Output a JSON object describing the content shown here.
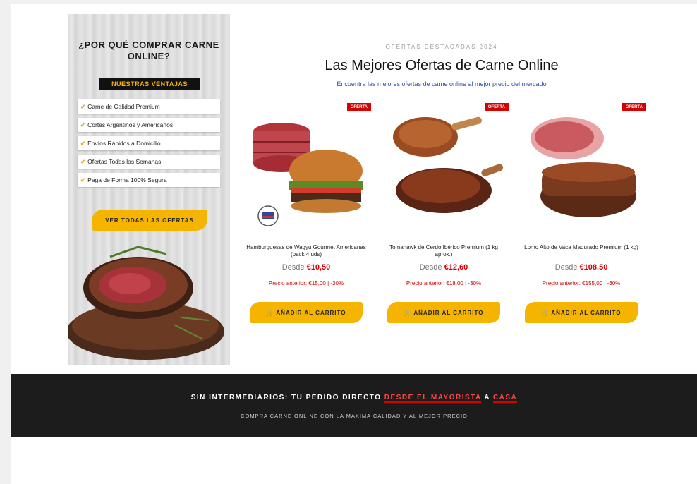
{
  "promo": {
    "title": "¿Por qué comprar carne online?",
    "badge": "NUESTRAS VENTAJAS",
    "benefits": [
      "Carne de Calidad Premium",
      "Cortes Argentinos y Americanos",
      "Envíos Rápidos a Domicilio",
      "Ofertas Todas las Semanas",
      "Paga de Forma 100% Segura"
    ],
    "cta": "VER TODAS LAS OFERTAS"
  },
  "heading": {
    "eyebrow": "OFERTAS DESTACADAS 2024",
    "title": "Las Mejores Ofertas de Carne Online",
    "tagline": "Encuentra las mejores ofertas de carne online al mejor precio del mercado"
  },
  "products": [
    {
      "tag": "OFERTA",
      "name": "Hamburguesas de Wagyu Gourmet Americanas (pack 4 uds)",
      "price_label": "Desde",
      "price": "€10,50",
      "saving": "Precio anterior: €15,00 | -30%",
      "buy": "AÑADIR AL CARRITO"
    },
    {
      "tag": "OFERTA",
      "name": "Tomahawk de Cerdo Ibérico Premium (1 kg aprox.)",
      "price_label": "Desde",
      "price": "€12,60",
      "saving": "Precio anterior: €18,00 | -30%",
      "buy": "AÑADIR AL CARRITO"
    },
    {
      "tag": "OFERTA",
      "name": "Lomo Alto de Vaca Madurado Premium (1 kg)",
      "price_label": "Desde",
      "price": "€108,50",
      "saving": "Precio anterior: €155,00 | -30%",
      "buy": "AÑADIR AL CARRITO"
    }
  ],
  "band": {
    "pre": "SIN INTERMEDIARIOS: TU PEDIDO DIRECTO ",
    "hl1": "DESDE EL MAYORISTA",
    "mid": " A ",
    "hl2": "CASA",
    "sub": "COMPRA CARNE ONLINE CON LA MÁXIMA CALIDAD Y AL MEJOR PRECIO"
  },
  "colors": {
    "accent": "#f5b400",
    "sale": "#d50000",
    "band": "#1c1c1c"
  }
}
